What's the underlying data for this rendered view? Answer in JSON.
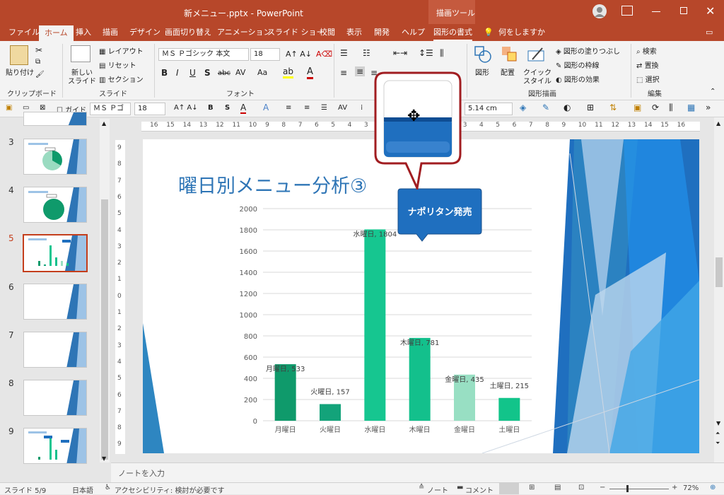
{
  "window": {
    "title": "新メニュー.pptx  -  PowerPoint",
    "context_title": "描画ツール"
  },
  "tabs": [
    "ファイル",
    "ホーム",
    "挿入",
    "描画",
    "デザイン",
    "画面切り替え",
    "アニメーション",
    "スライド ショー",
    "校閲",
    "表示",
    "開発",
    "ヘルプ",
    "図形の書式"
  ],
  "tell_me": "何をしますか",
  "ribbon": {
    "clipboard": {
      "paste": "貼り付け",
      "label": "クリップボード"
    },
    "slides": {
      "new_slide_1": "新しい",
      "new_slide_2": "スライド",
      "layout": "レイアウト",
      "reset": "リセット",
      "section": "セクション",
      "label": "スライド"
    },
    "font": {
      "name": "ＭＳ Ｐゴシック 本文",
      "size": "18",
      "label": "フォント"
    },
    "drawing": {
      "shapes": "図形",
      "arrange": "配置",
      "quick_styles_1": "クイック",
      "quick_styles_2": "スタイル",
      "fill": "図形の塗りつぶし",
      "outline": "図形の枠線",
      "effects": "図形の効果",
      "label": "図形描画"
    },
    "editing": {
      "find": "検索",
      "replace": "置換",
      "select": "選択",
      "label": "編集"
    }
  },
  "qat": {
    "guide": "ガイド",
    "font": "ＭＳ Ｐゴ",
    "size": "18",
    "width": "5.14 cm"
  },
  "thumbnails": [
    {
      "num": "3"
    },
    {
      "num": "4"
    },
    {
      "num": "5"
    },
    {
      "num": "6"
    },
    {
      "num": "7"
    },
    {
      "num": "8"
    },
    {
      "num": "9"
    }
  ],
  "slide": {
    "title": "曜日別メニュー分析③",
    "callout": "ナポリタン発売"
  },
  "chart_data": {
    "type": "bar",
    "categories": [
      "月曜日",
      "火曜日",
      "水曜日",
      "木曜日",
      "金曜日",
      "土曜日"
    ],
    "values": [
      533,
      157,
      1804,
      781,
      435,
      215
    ],
    "data_labels": [
      "月曜日, 533",
      "火曜日, 157",
      "水曜日, 1804",
      "木曜日, 781",
      "金曜日, 435",
      "土曜日, 215"
    ],
    "ylim": [
      0,
      2000
    ],
    "yticks": [
      "0",
      "200",
      "400",
      "600",
      "800",
      "1000",
      "1200",
      "1400",
      "1600",
      "1800",
      "2000"
    ],
    "colors": [
      "#0f9a6b",
      "#13a37a",
      "#16c690",
      "#13c08c",
      "#98dfc3",
      "#12c48a"
    ],
    "grid": true
  },
  "notes": {
    "placeholder": "ノートを入力"
  },
  "status": {
    "slide": "スライド 5/9",
    "lang": "日本語",
    "accessibility": "アクセシビリティ: 検討が必要です",
    "notes": "ノート",
    "comments": "コメント",
    "zoom": "72%"
  },
  "ruler_h": [
    "16",
    "15",
    "14",
    "13",
    "12",
    "11",
    "10",
    "9",
    "8",
    "7",
    "6",
    "5",
    "4",
    "3",
    "2",
    "1",
    "0",
    "1",
    "2",
    "3",
    "4",
    "5",
    "6",
    "7",
    "8",
    "9",
    "10",
    "11",
    "12",
    "13",
    "14",
    "15",
    "16"
  ],
  "ruler_v": [
    "9",
    "8",
    "7",
    "6",
    "5",
    "4",
    "3",
    "2",
    "1",
    "0",
    "1",
    "2",
    "3",
    "4",
    "5",
    "6",
    "7",
    "8",
    "9"
  ],
  "colors": {
    "accent": "#b7472a",
    "title": "#2e75b6",
    "callout": "#1f6fbf"
  }
}
